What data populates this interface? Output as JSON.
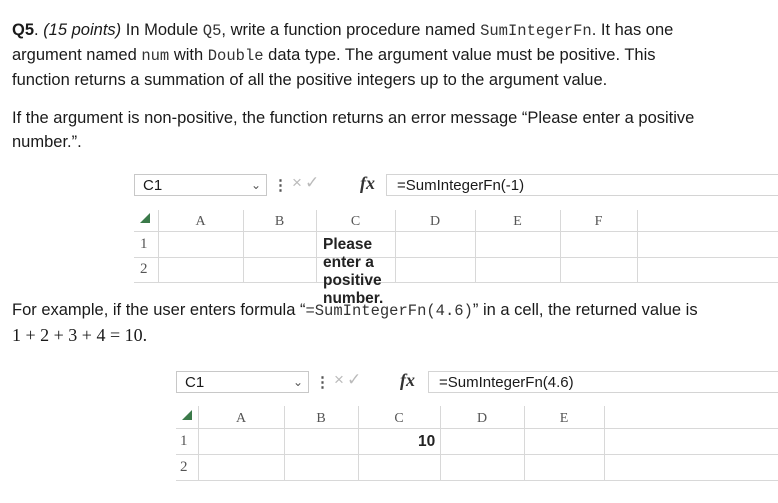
{
  "question": {
    "label": "Q5",
    "points": "(15 points)",
    "text_1": " In Module ",
    "module": "Q5",
    "text_2": ", write a function procedure named ",
    "fn_name": "SumIntegerFn",
    "text_3": ". It has one",
    "text_4": "argument named ",
    "arg_name": "num",
    "text_5": " with ",
    "type_name": "Double",
    "text_6": " data type. The argument value must be positive. This",
    "text_7": "function returns a summation of all the positive integers up to the argument value."
  },
  "error_para": {
    "line_1": "If the argument is non-positive, the function returns an error message “Please enter a positive",
    "line_2": "number.”."
  },
  "sheet_1": {
    "name_box": "C1",
    "formula": "=SumIntegerFn(-1)",
    "fx": "fx",
    "columns": [
      "A",
      "B",
      "C",
      "D",
      "E",
      "F"
    ],
    "rows": [
      "1",
      "2"
    ],
    "cell_value": "Please enter a positive number."
  },
  "example_para": {
    "text_1": "For example, if the user enters formula “",
    "code": "=SumIntegerFn(4.6)",
    "text_2": "” in a cell, the returned value is",
    "math": "1 + 2 + 3 + 4 = 10."
  },
  "sheet_2": {
    "name_box": "C1",
    "formula": "=SumIntegerFn(4.6)",
    "fx": "fx",
    "columns": [
      "A",
      "B",
      "C",
      "D",
      "E"
    ],
    "rows": [
      "1",
      "2"
    ],
    "cell_value": "10"
  },
  "icons": {
    "cancel": "×",
    "confirm": "✓",
    "chevron": "⌄",
    "more": "⋮"
  }
}
